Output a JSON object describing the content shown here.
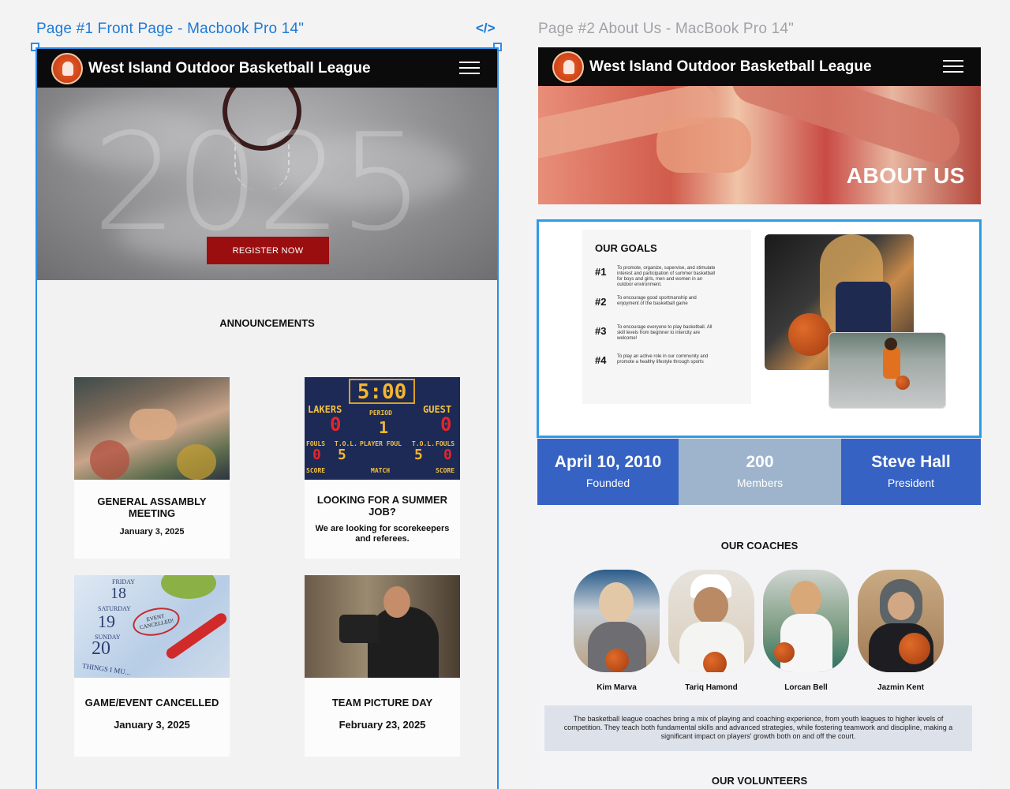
{
  "canvas": {
    "frame1_label": "Page #1 Front Page - Macbook Pro 14\"",
    "frame2_label": "Page #2 About Us - MacBook Pro 14\"",
    "code_toggle": "</>"
  },
  "brand": {
    "name": "West Island Outdoor Basketball League"
  },
  "front": {
    "hero_year": "2025",
    "register_label": "REGISTER NOW",
    "announcements_title": "ANNOUNCEMENTS",
    "cards": [
      {
        "title": "GENERAL ASSAMBLY MEETING",
        "date": "January 3, 2025"
      },
      {
        "title": "LOOKING FOR A SUMMER JOB?",
        "text": "We are looking for scorekeepers and referees."
      },
      {
        "title": "GAME/EVENT CANCELLED",
        "date": "January 3, 2025"
      },
      {
        "title": "TEAM PICTURE DAY",
        "date": "February 23, 2025"
      }
    ],
    "scoreboard": {
      "clock": "5:00",
      "home": "LAKERS",
      "guest": "GUEST",
      "period_label": "PERIOD",
      "period": "1",
      "home_score": "0",
      "guest_score": "0",
      "fouls_label": "FOULS",
      "tol_label": "T.O.L.",
      "player_foul_label": "PLAYER FOUL",
      "score_label": "SCORE",
      "match_label": "MATCH",
      "home_fouls": "0",
      "home_tol": "5",
      "guest_tol": "5",
      "guest_fouls": "0"
    },
    "calendar": {
      "fri": "FRIDAY",
      "d18": "18",
      "sat": "SATURDAY",
      "d19": "19",
      "sun": "SUNDAY",
      "d20": "20",
      "note": "EVENT CANCELLED!",
      "footer": "THINGS I MU..."
    }
  },
  "about": {
    "hero_title": "ABOUT US",
    "goals_title": "OUR GOALS",
    "goals": [
      {
        "num": "#1",
        "text": "To promote, organize, supervise, and stimulate interest and participation of summer basketball for boys and girls, men and women in an outdoor environment."
      },
      {
        "num": "#2",
        "text": "To encourage good sportmanship and enjoyment of the basketball game"
      },
      {
        "num": "#3",
        "text": "To encourage everyone to play basketball. All skill levels from beginner to intercity are welcome!"
      },
      {
        "num": "#4",
        "text": "To play an active role in our community and promote a healthy lifestyle through sports"
      }
    ],
    "stats": [
      {
        "value": "April 10, 2010",
        "label": "Founded"
      },
      {
        "value": "200",
        "label": "Members"
      },
      {
        "value": "Steve Hall",
        "label": "President"
      }
    ],
    "coaches_title": "OUR COACHES",
    "coaches": [
      "Kim Marva",
      "Tariq Hamond",
      "Lorcan Bell",
      "Jazmin Kent"
    ],
    "coaches_desc": "The basketball league coaches bring a mix of playing and coaching experience, from youth leagues to higher levels of competition. They teach both fundamental skills and advanced strategies, while fostering teamwork and discipline, making a significant impact on players' growth both on and off the court.",
    "volunteers_title": "OUR VOLUNTEERS"
  },
  "colors": {
    "accent_blue": "#2a8ce8",
    "register_red": "#9b0e10",
    "stat_blue": "#3562c3",
    "stat_light": "#9db4cc"
  }
}
